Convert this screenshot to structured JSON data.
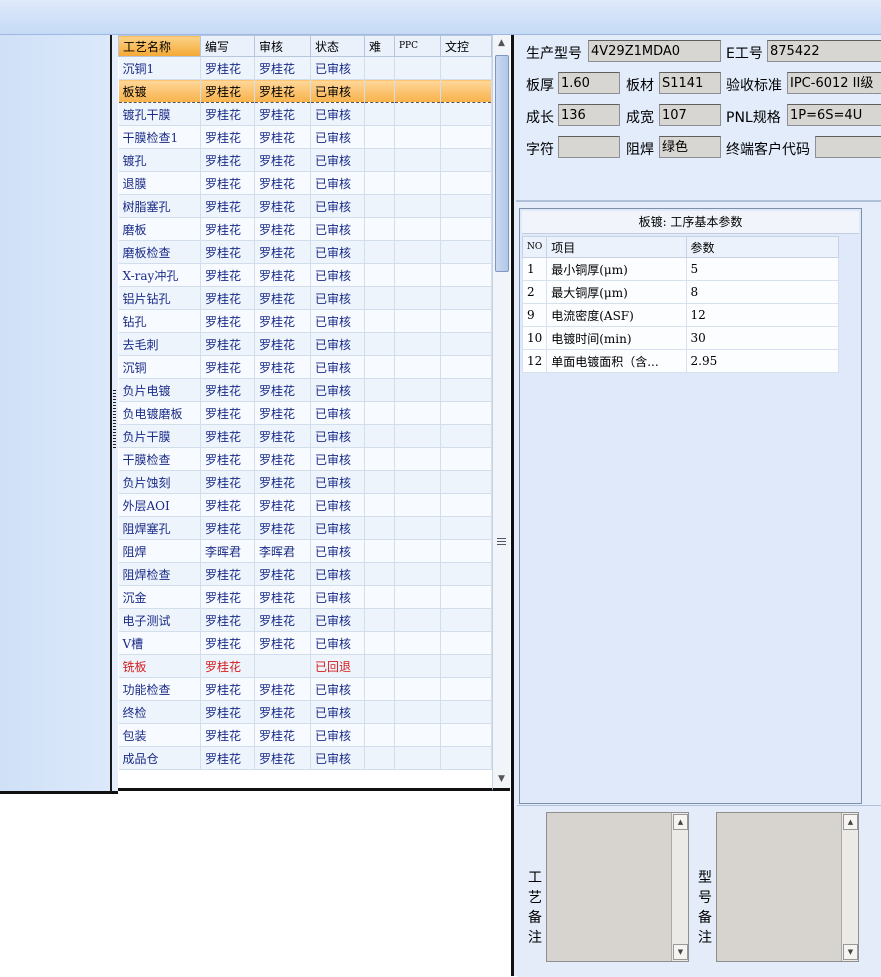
{
  "process_grid": {
    "columns": [
      "工艺名称",
      "编写",
      "审核",
      "状态",
      "难",
      "PPC",
      "文控"
    ],
    "rows": [
      {
        "name": "沉铜1",
        "writer": "罗桂花",
        "reviewer": "罗桂花",
        "status": "已审核"
      },
      {
        "name": "板镀",
        "writer": "罗桂花",
        "reviewer": "罗桂花",
        "status": "已审核"
      },
      {
        "name": "镀孔干膜",
        "writer": "罗桂花",
        "reviewer": "罗桂花",
        "status": "已审核"
      },
      {
        "name": "干膜检查1",
        "writer": "罗桂花",
        "reviewer": "罗桂花",
        "status": "已审核"
      },
      {
        "name": "镀孔",
        "writer": "罗桂花",
        "reviewer": "罗桂花",
        "status": "已审核"
      },
      {
        "name": "退膜",
        "writer": "罗桂花",
        "reviewer": "罗桂花",
        "status": "已审核"
      },
      {
        "name": "树脂塞孔",
        "writer": "罗桂花",
        "reviewer": "罗桂花",
        "status": "已审核"
      },
      {
        "name": "磨板",
        "writer": "罗桂花",
        "reviewer": "罗桂花",
        "status": "已审核"
      },
      {
        "name": "磨板检查",
        "writer": "罗桂花",
        "reviewer": "罗桂花",
        "status": "已审核"
      },
      {
        "name": "X-ray冲孔",
        "writer": "罗桂花",
        "reviewer": "罗桂花",
        "status": "已审核"
      },
      {
        "name": "铝片钻孔",
        "writer": "罗桂花",
        "reviewer": "罗桂花",
        "status": "已审核"
      },
      {
        "name": "钻孔",
        "writer": "罗桂花",
        "reviewer": "罗桂花",
        "status": "已审核"
      },
      {
        "name": "去毛刺",
        "writer": "罗桂花",
        "reviewer": "罗桂花",
        "status": "已审核"
      },
      {
        "name": "沉铜",
        "writer": "罗桂花",
        "reviewer": "罗桂花",
        "status": "已审核"
      },
      {
        "name": "负片电镀",
        "writer": "罗桂花",
        "reviewer": "罗桂花",
        "status": "已审核"
      },
      {
        "name": "负电镀磨板",
        "writer": "罗桂花",
        "reviewer": "罗桂花",
        "status": "已审核"
      },
      {
        "name": "负片干膜",
        "writer": "罗桂花",
        "reviewer": "罗桂花",
        "status": "已审核"
      },
      {
        "name": "干膜检查",
        "writer": "罗桂花",
        "reviewer": "罗桂花",
        "status": "已审核"
      },
      {
        "name": "负片蚀刻",
        "writer": "罗桂花",
        "reviewer": "罗桂花",
        "status": "已审核"
      },
      {
        "name": "外层AOI",
        "writer": "罗桂花",
        "reviewer": "罗桂花",
        "status": "已审核"
      },
      {
        "name": "阻焊塞孔",
        "writer": "罗桂花",
        "reviewer": "罗桂花",
        "status": "已审核"
      },
      {
        "name": "阻焊",
        "writer": "李晖君",
        "reviewer": "李晖君",
        "status": "已审核"
      },
      {
        "name": "阻焊检查",
        "writer": "罗桂花",
        "reviewer": "罗桂花",
        "status": "已审核"
      },
      {
        "name": "沉金",
        "writer": "罗桂花",
        "reviewer": "罗桂花",
        "status": "已审核"
      },
      {
        "name": "电子测试",
        "writer": "罗桂花",
        "reviewer": "罗桂花",
        "status": "已审核"
      },
      {
        "name": "V槽",
        "writer": "罗桂花",
        "reviewer": "罗桂花",
        "status": "已审核"
      },
      {
        "name": "铣板",
        "writer": "罗桂花",
        "reviewer": "",
        "status": "已回退"
      },
      {
        "name": "功能检查",
        "writer": "罗桂花",
        "reviewer": "罗桂花",
        "status": "已审核"
      },
      {
        "name": "终检",
        "writer": "罗桂花",
        "reviewer": "罗桂花",
        "status": "已审核"
      },
      {
        "name": "包装",
        "writer": "罗桂花",
        "reviewer": "罗桂花",
        "status": "已审核"
      },
      {
        "name": "成品仓",
        "writer": "罗桂花",
        "reviewer": "罗桂花",
        "status": "已审核"
      }
    ],
    "selected_index": 1,
    "returned_index": 26
  },
  "info": {
    "model_label": "生产型号",
    "model_value": "4V29Z1MDA0",
    "eno_label": "E工号",
    "eno_value": "875422",
    "thickness_label": "板厚",
    "thickness_value": "1.60",
    "material_label": "板材",
    "material_value": "S1141",
    "standard_label": "验收标准",
    "standard_value": "IPC-6012 II级",
    "length_label": "成长",
    "length_value": "136",
    "width_label": "成宽",
    "width_value": "107",
    "pnl_label": "PNL规格",
    "pnl_value": "1P=6S=4U",
    "char_label": "字符",
    "char_value": "",
    "mask_label": "阻焊",
    "mask_value": "绿色",
    "customer_label": "终端客户代码",
    "customer_value": ""
  },
  "params": {
    "title": "板镀: 工序基本参数",
    "columns": [
      "NO",
      "项目",
      "参数"
    ],
    "rows": [
      {
        "no": "1",
        "item": "最小铜厚(μm)",
        "value": "5"
      },
      {
        "no": "2",
        "item": "最大铜厚(μm)",
        "value": "8"
      },
      {
        "no": "9",
        "item": "电流密度(ASF)",
        "value": "12"
      },
      {
        "no": "10",
        "item": "电镀时间(min)",
        "value": "30"
      },
      {
        "no": "12",
        "item": "单面电镀面积（含...",
        "value": "2.95"
      }
    ]
  },
  "remarks": {
    "process_remark_label": "工艺备注",
    "model_remark_label": "型号备注",
    "process_remark_chars": [
      "工",
      "艺",
      "备",
      "注"
    ],
    "model_remark_chars": [
      "型",
      "号",
      "备",
      "注"
    ]
  },
  "icons": {
    "scroll_up": "scroll-up-arrow-icon",
    "scroll_down": "scroll-down-arrow-icon"
  },
  "colors": {
    "selected_row": "#f8b24a",
    "returned_text": "#d21e1e",
    "grid_text": "#1a2b87"
  }
}
